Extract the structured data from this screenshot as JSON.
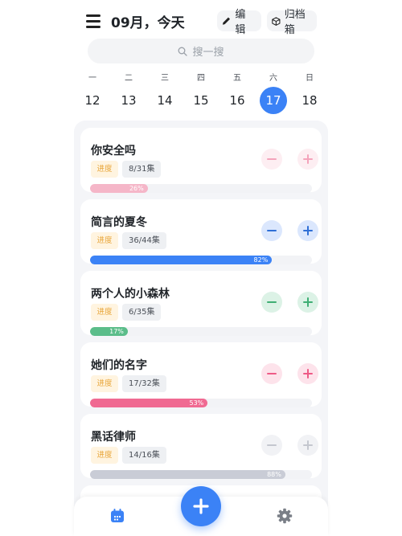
{
  "header": {
    "title": "09月，今天",
    "edit_label": "编辑",
    "archive_label": "归档箱"
  },
  "search": {
    "placeholder": "搜一搜"
  },
  "calendar": {
    "weekdays": [
      "一",
      "二",
      "三",
      "四",
      "五",
      "六",
      "日"
    ],
    "days": [
      "12",
      "13",
      "14",
      "15",
      "16",
      "17",
      "18"
    ],
    "selected_day": "17"
  },
  "progress_label": "进度",
  "shows": [
    {
      "title": "你安全吗",
      "episodes": "8/31集",
      "progress": 26,
      "progress_label": "26%",
      "color": "#f5b6c8",
      "minus_bg": "#fdeef2",
      "plus_bg": "#fdeef2",
      "icon_color": "#f4a3bb"
    },
    {
      "title": "简言的夏冬",
      "episodes": "36/44集",
      "progress": 82,
      "progress_label": "82%",
      "color": "#3b82f6",
      "minus_bg": "#dbe7fd",
      "plus_bg": "#dbe7fd",
      "icon_color": "#2f6fd6"
    },
    {
      "title": "两个人的小森林",
      "episodes": "6/35集",
      "progress": 17,
      "progress_label": "17%",
      "color": "#5bbd8a",
      "minus_bg": "#dcf2e6",
      "plus_bg": "#dcf2e6",
      "icon_color": "#3fae74"
    },
    {
      "title": "她们的名字",
      "episodes": "17/32集",
      "progress": 53,
      "progress_label": "53%",
      "color": "#f06a92",
      "minus_bg": "#fde3eb",
      "plus_bg": "#fde3eb",
      "icon_color": "#ee5a86"
    },
    {
      "title": "黑话律师",
      "episodes": "14/16集",
      "progress": 88,
      "progress_label": "88%",
      "color": "#c9ccd6",
      "minus_bg": "#f1f2f5",
      "plus_bg": "#f1f2f5",
      "icon_color": "#c4c7cf"
    }
  ],
  "colors": {
    "accent": "#3b82f6"
  }
}
